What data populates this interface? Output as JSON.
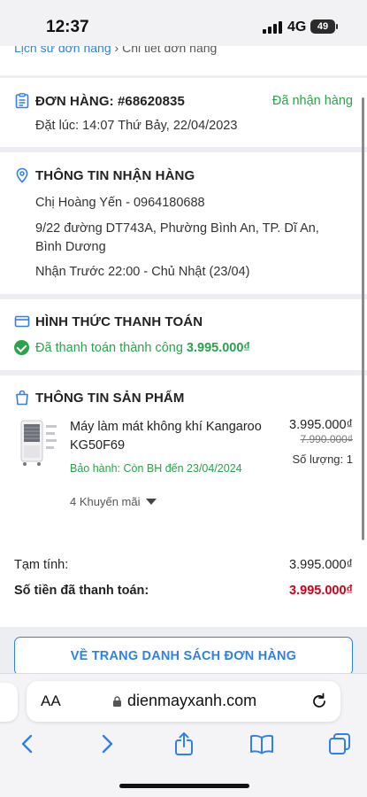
{
  "status_bar": {
    "time": "12:37",
    "network": "4G",
    "battery": "49"
  },
  "breadcrumb": {
    "link": "Lịch sử đơn hàng",
    "separator": "›",
    "current": "Chi tiết đơn hàng"
  },
  "order": {
    "title": "ĐƠN HÀNG: #68620835",
    "status": "Đã nhận hàng",
    "placed_at": "Đặt lúc: 14:07 Thứ Bảy, 22/04/2023"
  },
  "recipient": {
    "title": "THÔNG TIN NHẬN HÀNG",
    "name_phone": "Chị Hoàng Yến - 0964180688",
    "address": "9/22 đường DT743A, Phường Bình An, TP. Dĩ An, Bình Dương",
    "delivery": "Nhận Trước 22:00 - Chủ Nhật (23/04)"
  },
  "payment": {
    "title": "HÌNH THỨC THANH TOÁN",
    "status_text": "Đã thanh toán thành công",
    "amount": "3.995.000₫"
  },
  "product_section": {
    "title": "THÔNG TIN SẢN PHẨM",
    "name": "Máy làm mát không khí Kangaroo KG50F69",
    "warranty": "Bảo hành: Còn BH đến 23/04/2024",
    "promotions": "4 Khuyến mãi",
    "price": "3.995.000₫",
    "old_price": "7.990.000₫",
    "quantity": "Số lượng: 1"
  },
  "summary": {
    "subtotal_label": "Tạm tính:",
    "subtotal_value": "3.995.000₫",
    "paid_label": "Số tiền đã thanh toán:",
    "paid_value": "3.995.000₫"
  },
  "back_button": "VỀ TRANG DANH SÁCH ĐƠN HÀNG",
  "browser": {
    "text_size": "AA",
    "url": "dienmayxanh.com"
  },
  "colors": {
    "accent": "#2f80ed",
    "success": "#2ba24c",
    "price_red": "#d0021b"
  }
}
